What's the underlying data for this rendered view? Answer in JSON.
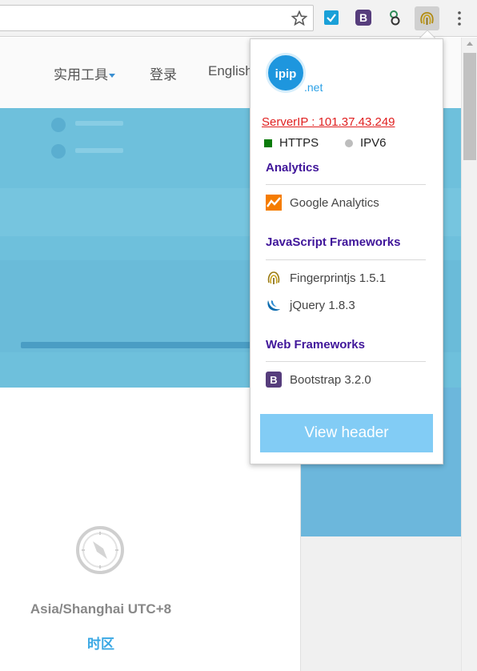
{
  "browser": {
    "extensions": [
      {
        "name": "checkbox-extension",
        "color": "#1aa0d8"
      },
      {
        "name": "bootstrap-extension",
        "letter": "B",
        "color": "#563d7c"
      },
      {
        "name": "refresh-extension",
        "color": "#2e8b57"
      },
      {
        "name": "fingerprint-extension",
        "color": "#c8a21b"
      }
    ]
  },
  "nav": {
    "tools": "实用工具",
    "login": "登录",
    "english": "English"
  },
  "timezone": {
    "value": "Asia/Shanghai UTC+8",
    "label": "时区"
  },
  "popup": {
    "logo_text": "ipip",
    "logo_suffix": ".net",
    "server_ip": "ServerIP : 101.37.43.249",
    "https": "HTTPS",
    "ipv6": "IPV6",
    "sections": [
      {
        "title": "Analytics",
        "items": [
          {
            "icon": "google-analytics-icon",
            "label": "Google Analytics"
          }
        ]
      },
      {
        "title": "JavaScript Frameworks",
        "items": [
          {
            "icon": "fingerprint-icon",
            "label": "Fingerprintjs 1.5.1"
          },
          {
            "icon": "jquery-icon",
            "label": "jQuery 1.8.3"
          }
        ]
      },
      {
        "title": "Web Frameworks",
        "items": [
          {
            "icon": "bootstrap-icon",
            "label": "Bootstrap 3.2.0"
          }
        ]
      }
    ],
    "view_header": "View header"
  },
  "colors": {
    "section_title": "#40169a",
    "server_ip": "#e02020",
    "https_indicator": "#0a7b0a",
    "button": "#82ccf5",
    "hero": "#6ec0dc",
    "accent": "#3aa8e4"
  }
}
